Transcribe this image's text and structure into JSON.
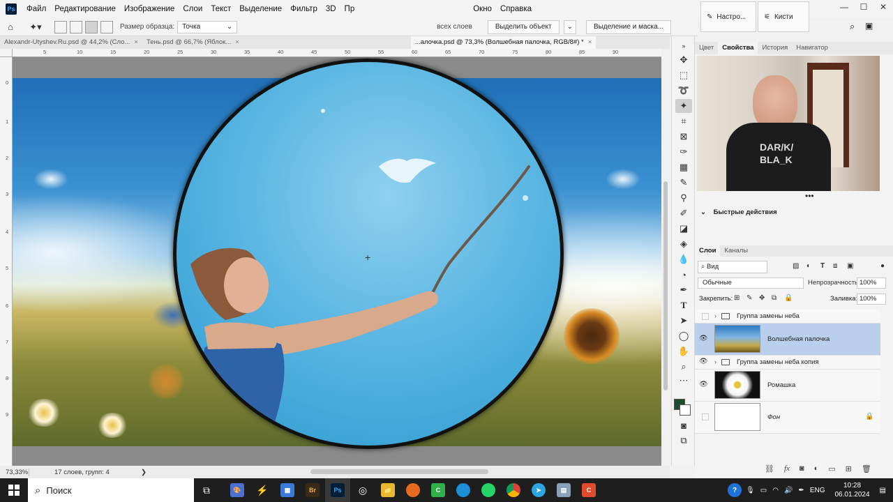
{
  "menu": {
    "app_icon": "Ps",
    "items": [
      "Файл",
      "Редактирование",
      "Изображение",
      "Слои",
      "Текст",
      "Выделение",
      "Фильтр",
      "3D",
      "Пр",
      "Окно",
      "Справка"
    ]
  },
  "options": {
    "sample_size_label": "Размер образца:",
    "sample_size_value": "Точка",
    "all_layers_fragment": "всех слоев",
    "select_subject": "Выделить объект",
    "select_and_mask": "Выделение и маска..."
  },
  "mini_panels": {
    "adjust_label": "Настро...",
    "brushes_label": "Кисти"
  },
  "doc_tabs": [
    {
      "label": "Alexandr-Utyshev.Ru.psd @ 44,2% (Сло..."
    },
    {
      "label": "Тень.psd @ 66,7% (Яблок..."
    },
    {
      "label": "...алочка.psd @ 73,3% (Волшебная палочка, RGB/8#) *",
      "active": true
    }
  ],
  "ruler_top": [
    "5",
    "10",
    "15",
    "20",
    "25",
    "30",
    "35",
    "40",
    "45",
    "50",
    "55",
    "60",
    "65",
    "70",
    "75",
    "80",
    "85",
    "90"
  ],
  "ruler_left": [
    "0",
    "1",
    "2",
    "3",
    "4",
    "5",
    "6",
    "7",
    "8",
    "9"
  ],
  "status": {
    "zoom": "73,33%",
    "layers_info": "17 слоев, групп: 4",
    "arrow": "❯"
  },
  "props_tabs": [
    "Цвет",
    "Свойства",
    "История",
    "Навигатор"
  ],
  "quick_actions_label": "Быстрые действия",
  "webcam": {
    "shirt_text_1": "DAR/K/",
    "shirt_text_2": "BLA_K"
  },
  "layers_tabs": [
    "Слои",
    "Каналы"
  ],
  "layers_filter": "Вид",
  "blend_mode": "Обычные",
  "opacity_label": "Непрозрачность:",
  "opacity_value": "100%",
  "lock_label": "Закрепить:",
  "fill_label": "Заливка:",
  "fill_value": "100%",
  "layers": [
    {
      "name": "Группа замены неба",
      "type": "group",
      "visible": false
    },
    {
      "name": "Волшебная палочка",
      "type": "image",
      "visible": true,
      "selected": true
    },
    {
      "name": "Группа замены неба копия",
      "type": "group",
      "visible": true
    },
    {
      "name": "Ромашка",
      "type": "image",
      "visible": true
    },
    {
      "name": "Фон",
      "type": "background",
      "visible": false,
      "locked": true
    }
  ],
  "taskbar": {
    "search_placeholder": "Поиск",
    "pinned": [
      "file-explorer",
      "whatsapp",
      "bridge",
      "photoshop",
      "capture",
      "folder",
      "firefox",
      "camtasia",
      "edge",
      "whatsapp-2",
      "chrome",
      "telegram",
      "files",
      "app"
    ],
    "bridge_label": "Br",
    "photoshop_label": "Ps",
    "language": "ENG",
    "time": "10:28",
    "date": "06.01.2024"
  },
  "colors": {
    "accent": "#31a8ff",
    "selected_layer": "#b9cfec",
    "foreground": "#1e4a32"
  }
}
